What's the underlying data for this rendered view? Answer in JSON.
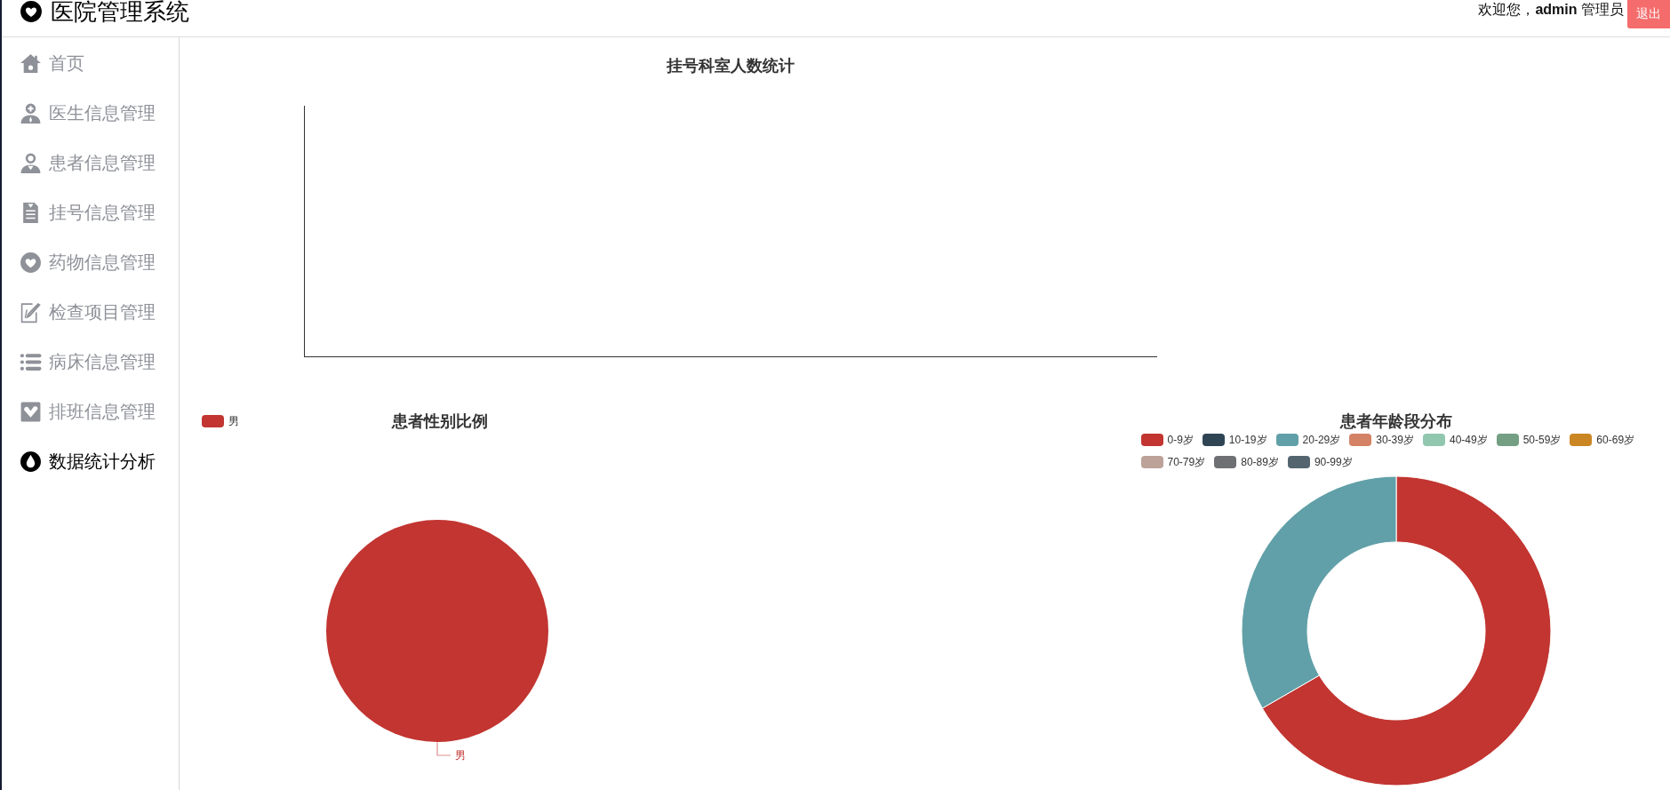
{
  "header": {
    "title": "医院管理系统",
    "welcome": "欢迎您，**admin** 管理员",
    "logout": "退出"
  },
  "sidebar": {
    "items": [
      {
        "label": "首页",
        "selected": false
      },
      {
        "label": "医生信息管理",
        "selected": false
      },
      {
        "label": "患者信息管理",
        "selected": false
      },
      {
        "label": "挂号信息管理",
        "selected": false
      },
      {
        "label": "药物信息管理",
        "selected": false
      },
      {
        "label": "检查项目管理",
        "selected": false
      },
      {
        "label": "病床信息管理",
        "selected": false
      },
      {
        "label": "排班信息管理",
        "selected": false
      },
      {
        "label": "数据统计分析",
        "selected": true
      }
    ]
  },
  "registration_chart": {
    "title": "挂号科室人数统计"
  },
  "gender_chart": {
    "title": "患者性别比例",
    "legend": [
      {
        "label": "男",
        "color": "#c23531"
      }
    ],
    "slice_labels": [
      "男"
    ]
  },
  "age_chart": {
    "title": "患者年龄段分布",
    "legend": [
      {
        "label": "0-9岁",
        "color": "#c23531"
      },
      {
        "label": "10-19岁",
        "color": "#2f4554"
      },
      {
        "label": "20-29岁",
        "color": "#61a0a8"
      },
      {
        "label": "30-39岁",
        "color": "#d48265"
      },
      {
        "label": "40-49岁",
        "color": "#91c7ae"
      },
      {
        "label": "50-59岁",
        "color": "#749f83"
      },
      {
        "label": "60-69岁",
        "color": "#ca8622"
      },
      {
        "label": "70-79岁",
        "color": "#bda29a"
      },
      {
        "label": "80-89岁",
        "color": "#6e7074"
      },
      {
        "label": "90-99岁",
        "color": "#546570"
      }
    ]
  }
}
